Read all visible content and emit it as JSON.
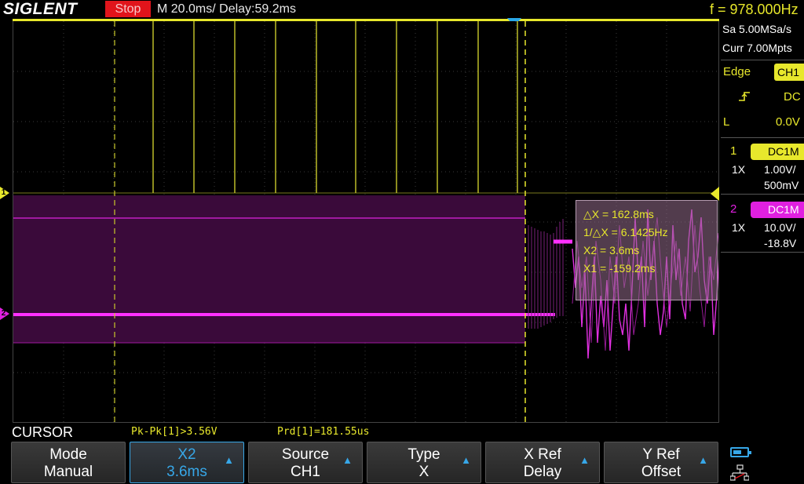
{
  "header": {
    "logo": "SIGLENT",
    "run_state": "Stop",
    "timebase": "M 20.0ms/ Delay:59.2ms",
    "frequency": "f = 978.000Hz"
  },
  "acquisition": {
    "sample_rate": "Sa 5.00MSa/s",
    "memory_depth": "Curr 7.00Mpts"
  },
  "trigger": {
    "type": "Edge",
    "source": "CH1",
    "slope_icon": "rising-edge-icon",
    "coupling": "DC",
    "mode": "L",
    "level": "0.0V"
  },
  "channels": [
    {
      "number": "1",
      "coupling": "DC1M",
      "probe": "1X",
      "scale": "1.00V/",
      "offset": "500mV",
      "color": "#e8e82c",
      "marker": "1"
    },
    {
      "number": "2",
      "coupling": "DC1M",
      "probe": "1X",
      "scale": "10.0V/",
      "offset": "-18.8V",
      "color": "#e020e0",
      "marker": "2"
    }
  ],
  "cursor_readout": {
    "delta_x": "△X = 162.8ms",
    "inv_delta_x": "1/△X = 6.1425Hz",
    "x2": "X2 = 3.6ms",
    "x1": "X1 = -159.2ms"
  },
  "status": {
    "menu_title": "CURSOR",
    "pkpk": "Pk-Pk[1]>3.56V",
    "period": "Prd[1]=181.55us"
  },
  "softkeys": {
    "mode": {
      "title": "Mode",
      "value": "Manual"
    },
    "x2": {
      "title": "X2",
      "value": "3.6ms"
    },
    "source": {
      "title": "Source",
      "value": "CH1"
    },
    "type": {
      "title": "Type",
      "value": "X"
    },
    "xref": {
      "title": "X Ref",
      "value": "Delay"
    },
    "yref": {
      "title": "Y Ref",
      "value": "Offset"
    }
  },
  "system_icons": [
    "battery-icon",
    "network-icon"
  ],
  "colors": {
    "ch1": "#e8e82c",
    "ch2": "#e020e0",
    "accent": "#37a7e8",
    "stop": "#e1141b"
  }
}
